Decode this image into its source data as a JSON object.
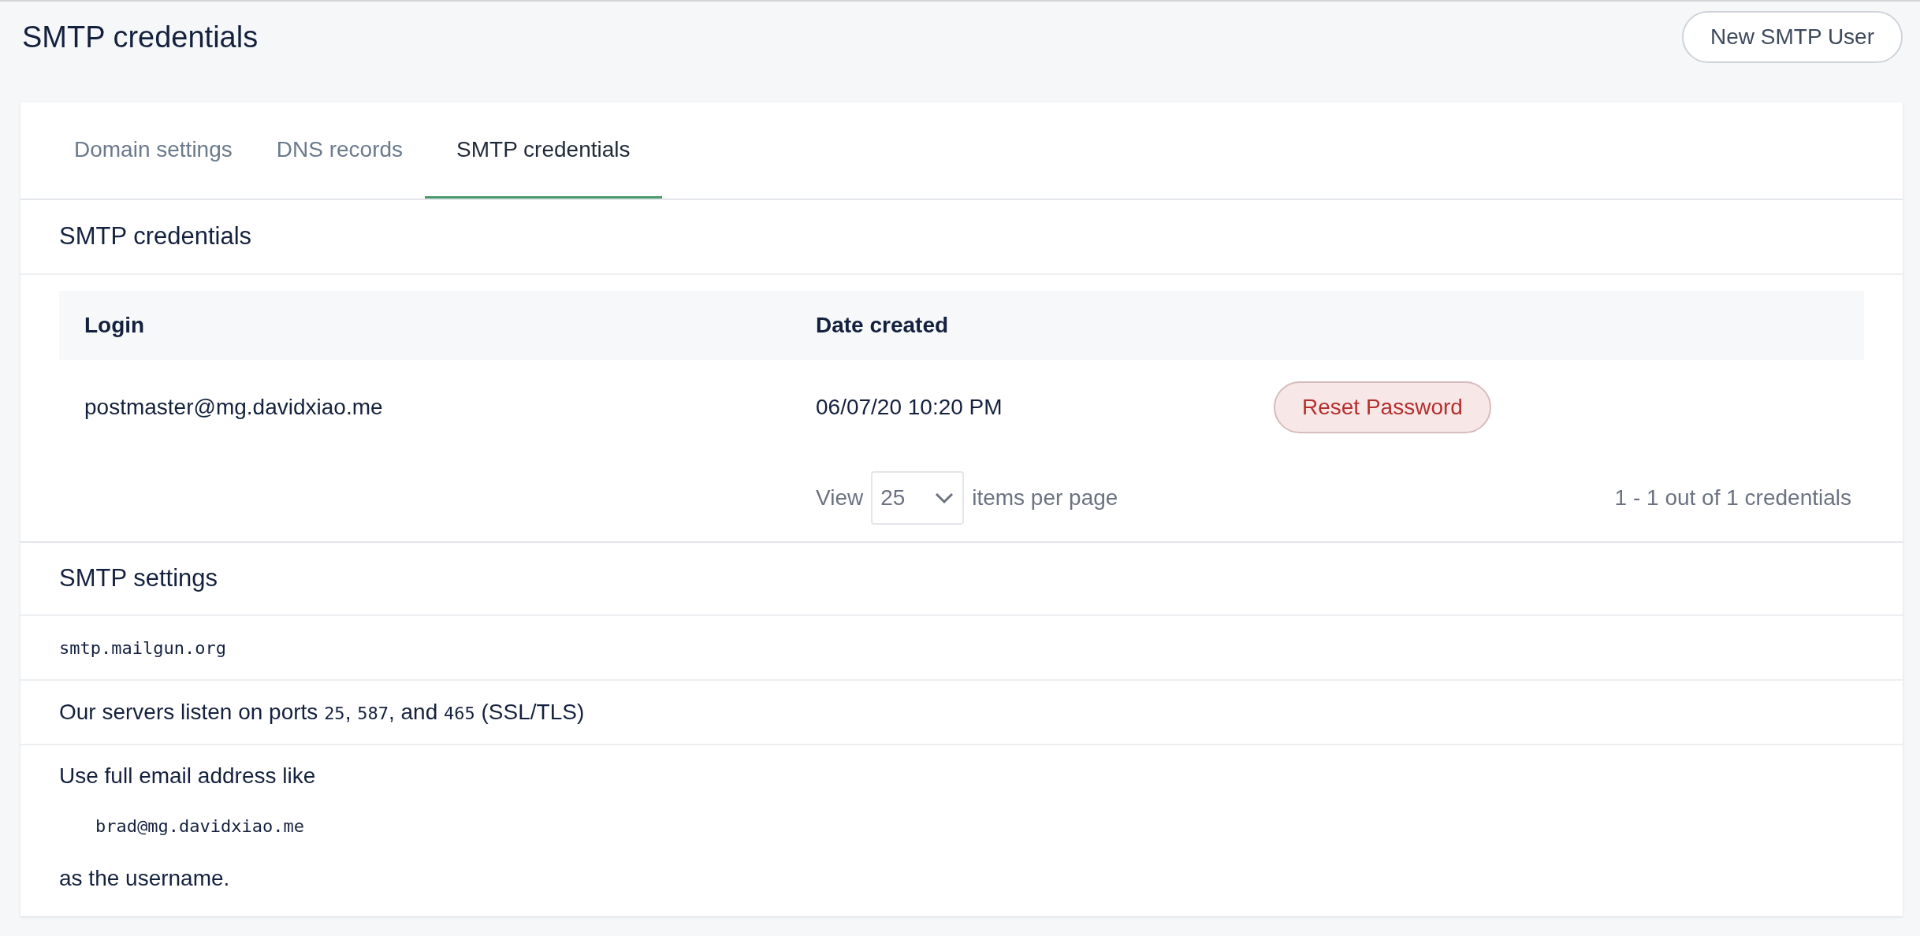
{
  "page_title": "SMTP credentials",
  "new_user_button": "New SMTP User",
  "tabs": [
    {
      "label": "Domain settings",
      "selected": false
    },
    {
      "label": "DNS records",
      "selected": false
    },
    {
      "label": "SMTP credentials",
      "selected": true
    }
  ],
  "credentials": {
    "title": "SMTP credentials",
    "columns": [
      "Login",
      "Date created"
    ],
    "rows": [
      {
        "login": "postmaster@mg.davidxiao.me",
        "date_created": "06/07/20 10:20 PM",
        "action": "Reset Password"
      }
    ],
    "pagination": {
      "view_label": "View",
      "per_page": "25",
      "items_label": "items per page",
      "summary": "1 - 1 out of 1 credentials"
    }
  },
  "settings": {
    "title": "SMTP settings",
    "host": "smtp.mailgun.org",
    "ports_note": [
      {
        "kind": "text",
        "text": "Our servers listen on ports "
      },
      {
        "kind": "code",
        "text": "25"
      },
      {
        "kind": "text",
        "text": ", "
      },
      {
        "kind": "code",
        "text": "587"
      },
      {
        "kind": "text",
        "text": ", and "
      },
      {
        "kind": "code",
        "text": "465"
      },
      {
        "kind": "text",
        "text": " (SSL/TLS)"
      }
    ],
    "username_intro": "Use full email address like",
    "username_example": "brad@mg.davidxiao.me",
    "username_outro": "as the username."
  }
}
